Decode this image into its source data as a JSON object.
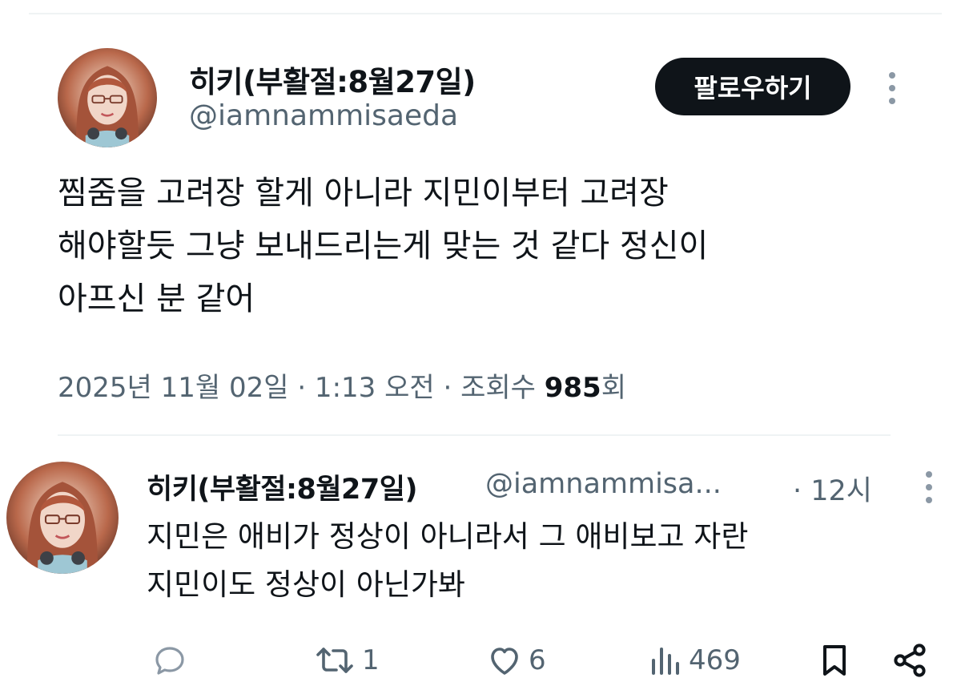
{
  "post": {
    "author_name": "히키(부활절:8월27일)",
    "author_handle": "@iamnammisaeda",
    "follow_label": "팔로우하기",
    "text_lines": [
      "찜줌을 고려장 할게 아니라 지민이부터 고려장",
      "해야할듯 그냥 보내드리는게 맞는 것 같다 정신이",
      "아프신 분 같어"
    ],
    "meta_prefix": "2025년 11월 02일 · 1:13 오전 · 조회수 ",
    "views": "985",
    "views_suffix": "회"
  },
  "reply": {
    "author_name": "히키(부활절:8월27일)",
    "author_handle": "@iamnammisa...",
    "time": "· 12시",
    "text_lines": [
      "지민은 애비가 정상이 아니라서 그 애비보고 자란",
      "지민이도 정상이 아닌가봐"
    ],
    "actions": {
      "reply_count": "",
      "repost_count": "1",
      "like_count": "6",
      "view_count": "469"
    }
  },
  "icons": {
    "more": "more-vertical-icon",
    "reply": "reply-icon",
    "repost": "repost-icon",
    "like": "heart-icon",
    "views": "views-chart-icon",
    "bookmark": "bookmark-icon",
    "share": "share-icon"
  },
  "colors": {
    "text": "#0f1419",
    "secondary": "#536471",
    "button_bg": "#0f1419",
    "divider": "#eff3f4"
  }
}
